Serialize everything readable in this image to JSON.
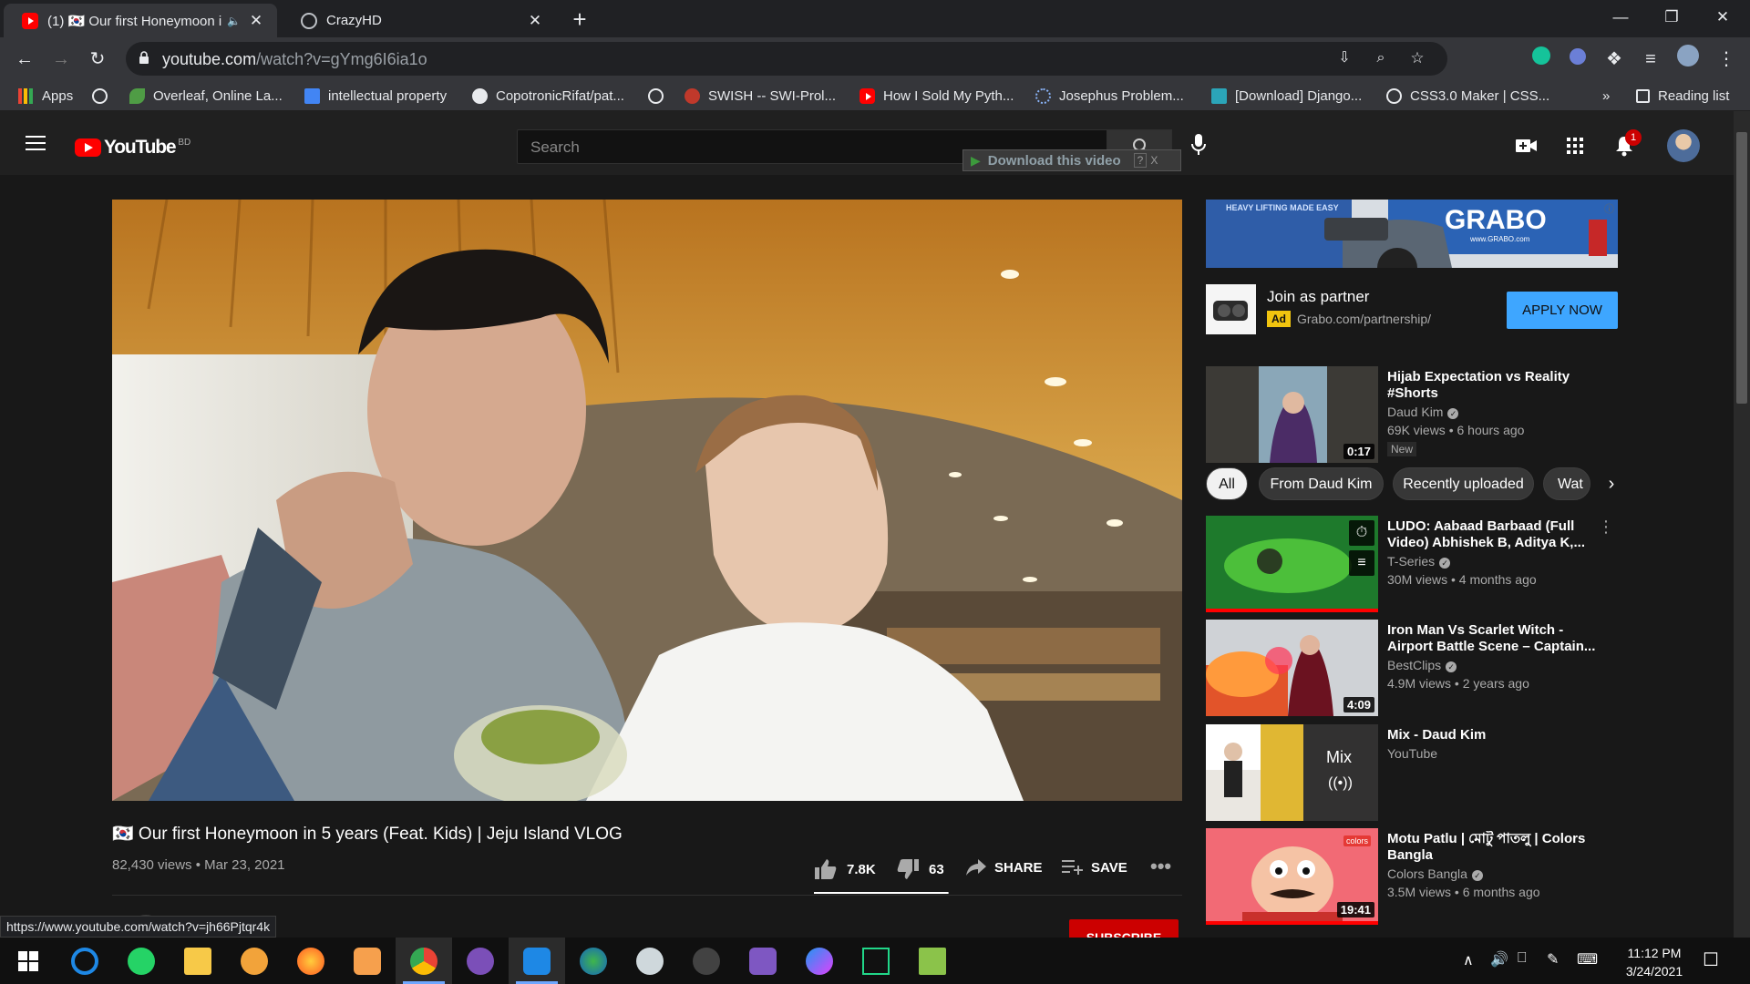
{
  "browser": {
    "tabs": [
      {
        "title": "(1) 🇰🇷 Our first Honeymoon i",
        "active": true
      },
      {
        "title": "CrazyHD",
        "active": false
      }
    ],
    "url_host": "youtube.com",
    "url_path": "/watch?v=gYmg6I6ia1o",
    "bookmarks": [
      "Apps",
      "Overleaf, Online La...",
      "intellectual property",
      "CopotronicRifat/pat...",
      "SWISH -- SWI-Prol...",
      "How I Sold My Pyth...",
      "Josephus Problem...",
      "[Download] Django...",
      "CSS3.0 Maker | CSS...",
      "Reading list"
    ],
    "bookmarks_more": "»"
  },
  "youtube": {
    "logo_text": "YouTube",
    "country_code": "BD",
    "search_placeholder": "Search",
    "download_bar_text": "Download this video",
    "download_help": "?",
    "download_close": "X",
    "notification_count": "1"
  },
  "video": {
    "title": "🇰🇷 Our first Honeymoon in 5 years (Feat. Kids) | Jeju Island VLOG",
    "meta": "82,430 views • Mar 23, 2021",
    "likes": "7.8K",
    "dislikes": "63",
    "like_ratio": 0.992,
    "share_label": "SHARE",
    "save_label": "SAVE",
    "subscribe_label": "SUBSCRIBE"
  },
  "ad": {
    "title": "Join as partner",
    "badge": "Ad",
    "url": "Grabo.com/partnership/",
    "cta": "APPLY NOW",
    "banner_brand": "GRABO",
    "banner_tagline": "HEAVY LIFTING MADE EASY",
    "banner_url": "www.GRABO.com"
  },
  "chips": [
    "All",
    "From Daud Kim",
    "Recently uploaded",
    "Wat"
  ],
  "recommendations": [
    {
      "title": "Hijab Expectation vs Reality #Shorts",
      "channel": "Daud Kim",
      "verified": true,
      "views": "69K views • 6 hours ago",
      "duration": "0:17",
      "badge": "New"
    },
    {
      "title": "LUDO: Aabaad Barbaad (Full Video) Abhishek B, Aditya K,...",
      "channel": "T-Series",
      "verified": true,
      "views": "30M views • 4 months ago",
      "duration": "",
      "watched": 1.0
    },
    {
      "title": "Iron Man Vs Scarlet Witch - Airport Battle Scene – Captain...",
      "channel": "BestClips",
      "verified": true,
      "views": "4.9M views • 2 years ago",
      "duration": "4:09"
    },
    {
      "title": "Mix - Daud Kim",
      "channel": "YouTube",
      "verified": false,
      "views": "",
      "duration": "",
      "mix_label": "Mix"
    },
    {
      "title": "Motu Patlu | মোটু পাতলু | Colors Bangla",
      "channel": "Colors Bangla",
      "verified": true,
      "views": "3.5M views • 6 months ago",
      "duration": "19:41",
      "watched": 1.0,
      "thumb_label": "colors"
    }
  ],
  "status_url": "https://www.youtube.com/watch?v=jh66Pjtqr4k",
  "taskbar": {
    "time": "11:12 PM",
    "date": "3/24/2021"
  }
}
